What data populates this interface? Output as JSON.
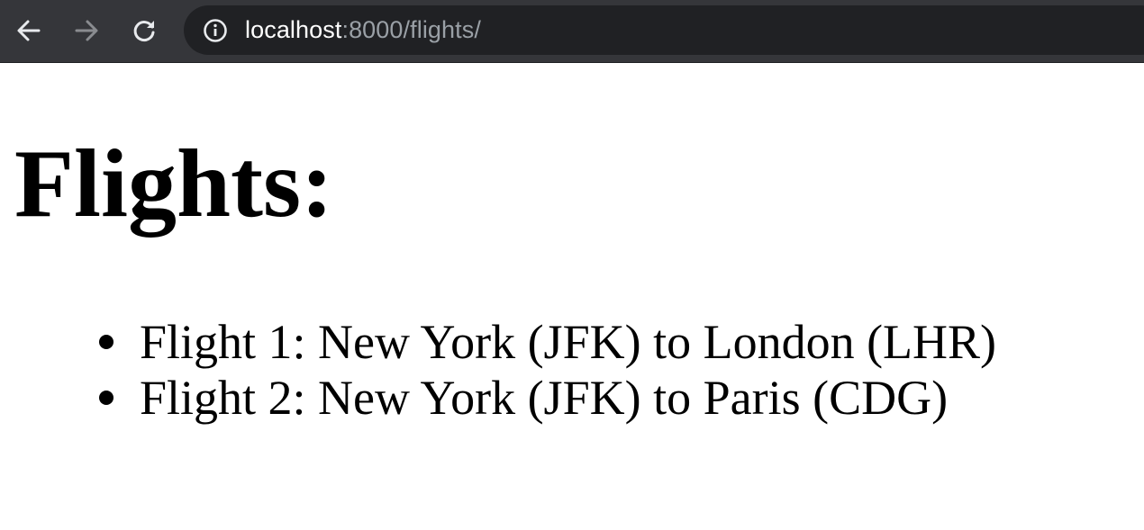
{
  "browser": {
    "url_host": "localhost",
    "url_rest": ":8000/flights/",
    "icons": {
      "back": "back-arrow-icon",
      "forward": "forward-arrow-icon",
      "reload": "reload-icon",
      "site_info": "info-icon"
    },
    "colors": {
      "toolbar": "#35363a",
      "omnibox": "#202124",
      "url_host": "#ffffff",
      "url_rest": "#9aa0a6"
    }
  },
  "page": {
    "title": "Flights:",
    "flights": [
      "Flight 1: New York (JFK) to London (LHR)",
      "Flight 2: New York (JFK) to Paris (CDG)"
    ]
  }
}
